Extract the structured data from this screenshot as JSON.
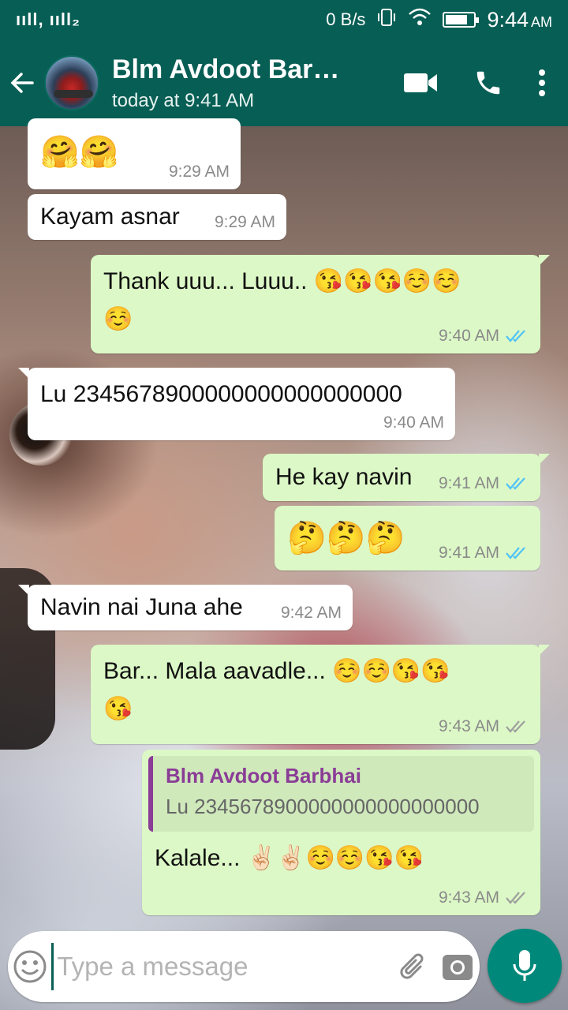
{
  "status_bar": {
    "signal": "ııll, ııll₂",
    "network_speed": "0 B/s",
    "time": "9:44",
    "ampm": "AM"
  },
  "header": {
    "contact_name": "Blm Avdoot Barbhai",
    "last_seen": "today at 9:41 AM"
  },
  "messages": [
    {
      "direction": "in",
      "text": "🤗🤗",
      "time": "9:29 AM"
    },
    {
      "direction": "in",
      "text": "Kayam asnar",
      "time": "9:29 AM"
    },
    {
      "direction": "out",
      "text": "Thank uuu... Luuu.. 😘😘😘☺️☺️",
      "text_line2": "☺️",
      "time": "9:40 AM",
      "status": "read"
    },
    {
      "direction": "in",
      "text": "Lu 2345678900000000000000000",
      "time": "9:40 AM"
    },
    {
      "direction": "out",
      "text": "He kay navin",
      "time": "9:41 AM",
      "status": "read"
    },
    {
      "direction": "out",
      "text": "🤔🤔🤔",
      "time": "9:41 AM",
      "status": "read"
    },
    {
      "direction": "in",
      "text": "Navin nai Juna ahe",
      "time": "9:42 AM"
    },
    {
      "direction": "out",
      "text": "Bar... Mala aavadle... ☺️☺️😘😘",
      "text_line2": "😘",
      "time": "9:43 AM",
      "status": "delivered"
    },
    {
      "direction": "out",
      "quoted": {
        "name": "Blm Avdoot Barbhai",
        "text": "Lu 2345678900000000000000000"
      },
      "text": "Kalale... ✌🏻✌🏻☺️☺️😘😘",
      "time": "9:43 AM",
      "status": "delivered"
    }
  ],
  "input": {
    "placeholder": "Type a message"
  },
  "colors": {
    "header": "#075e54",
    "outgoing_bubble": "#dcf8c6",
    "incoming_bubble": "#ffffff",
    "read_ticks": "#4fc3f7",
    "delivered_ticks": "#9e9e9e",
    "mic_button": "#00897b",
    "quote_accent": "#8a3c96"
  },
  "icons": {
    "back": "arrow-left-icon",
    "video": "video-camera-icon",
    "call": "phone-icon",
    "menu": "more-vertical-icon",
    "emoji": "smiley-icon",
    "attach": "paperclip-icon",
    "camera": "camera-icon",
    "mic": "microphone-icon"
  }
}
